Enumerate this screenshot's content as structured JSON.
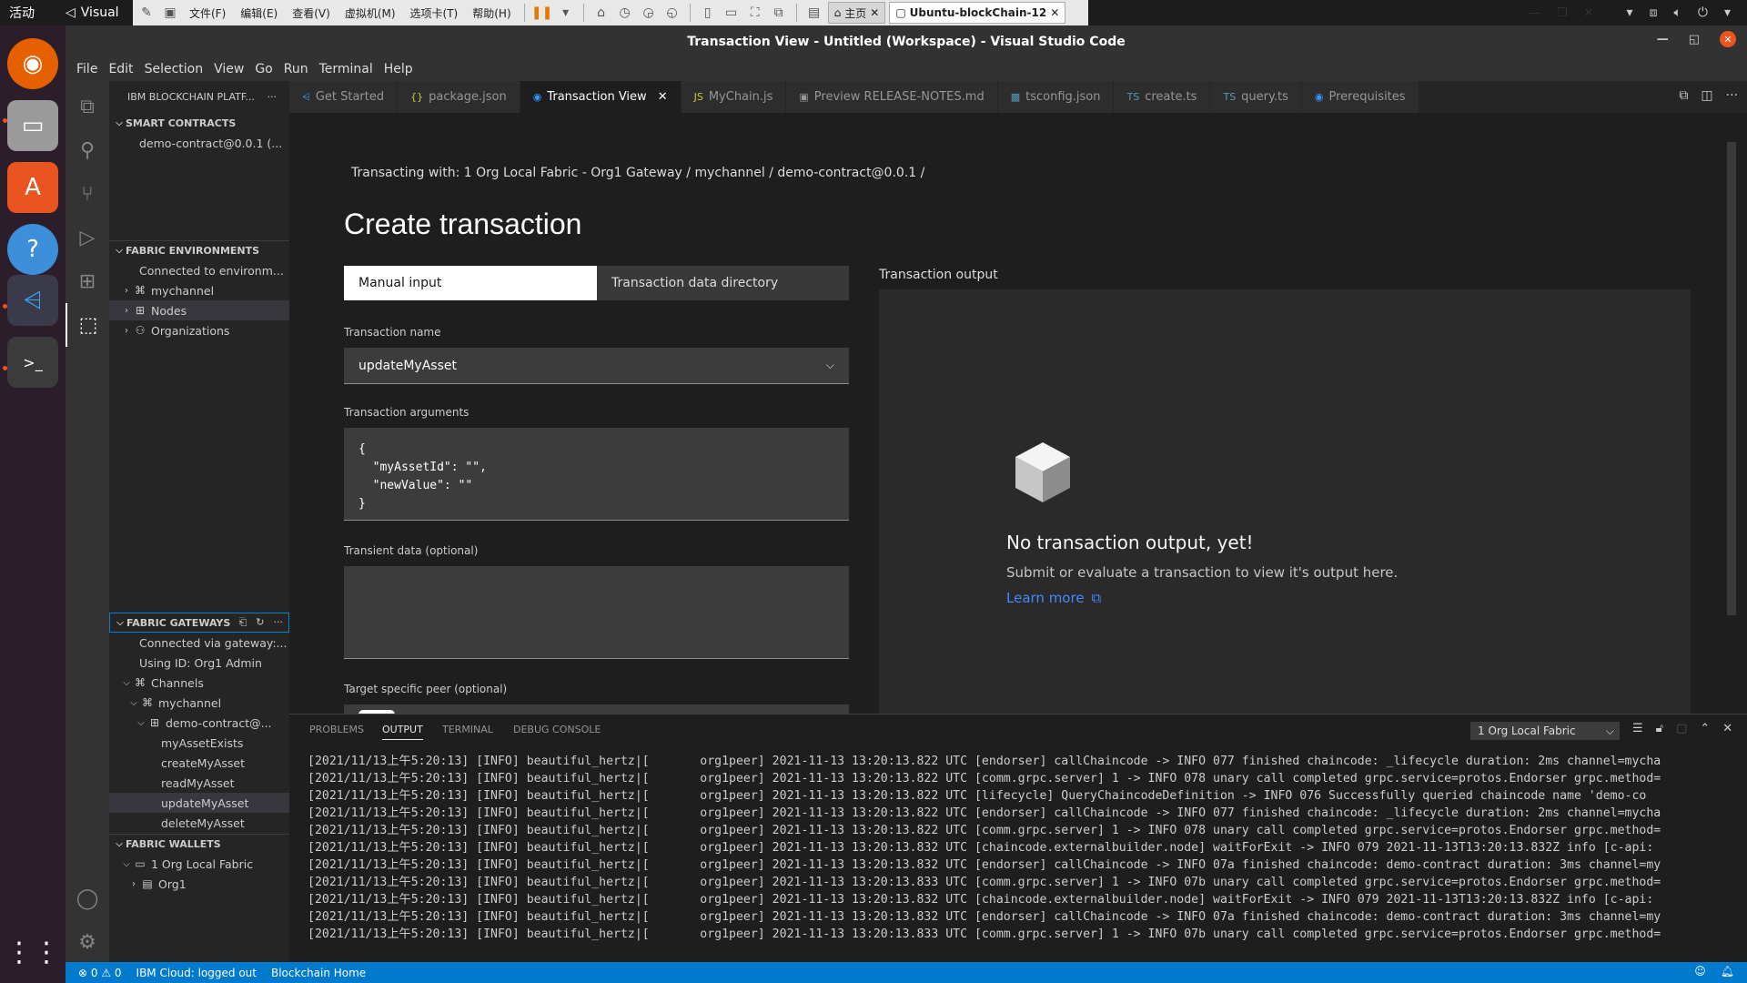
{
  "system": {
    "activities": "活动",
    "app_short": "Visual",
    "vm_menu": [
      "文件(F)",
      "编辑(E)",
      "查看(V)",
      "虚拟机(M)",
      "选项卡(T)",
      "帮助(H)"
    ],
    "vm_tabs": [
      {
        "label": "主页",
        "active": false
      },
      {
        "label": "Ubuntu-blockChain-12",
        "active": true
      }
    ]
  },
  "window": {
    "title": "Transaction View - Untitled (Workspace) - Visual Studio Code",
    "menu": [
      "File",
      "Edit",
      "Selection",
      "View",
      "Go",
      "Run",
      "Terminal",
      "Help"
    ]
  },
  "sidebar": {
    "title": "IBM BLOCKCHAIN PLATF...",
    "smart_contracts": {
      "header": "SMART CONTRACTS",
      "items": [
        "demo-contract@0.0.1 (..."
      ]
    },
    "fabric_environments": {
      "header": "FABRIC ENVIRONMENTS",
      "connected": "Connected to environm...",
      "items": [
        "mychannel",
        "Nodes",
        "Organizations"
      ]
    },
    "fabric_gateways": {
      "header": "FABRIC GATEWAYS",
      "connected": "Connected via gateway:...",
      "using_id": "Using ID: Org1 Admin",
      "channels": "Channels",
      "channel": "mychannel",
      "contract": "demo-contract@...",
      "transactions": [
        "myAssetExists",
        "createMyAsset",
        "readMyAsset",
        "updateMyAsset",
        "deleteMyAsset"
      ]
    },
    "fabric_wallets": {
      "header": "FABRIC WALLETS",
      "wallet": "1 Org Local Fabric",
      "org": "Org1"
    }
  },
  "tabs": [
    {
      "label": "Get Started",
      "icon": "vscode-icon",
      "active": false
    },
    {
      "label": "package.json",
      "icon": "json-icon",
      "active": false
    },
    {
      "label": "Transaction View",
      "icon": "blockchain-icon",
      "active": true
    },
    {
      "label": "MyChain.js",
      "icon": "js-icon",
      "active": false
    },
    {
      "label": "Preview RELEASE-NOTES.md",
      "icon": "preview-icon",
      "active": false
    },
    {
      "label": "tsconfig.json",
      "icon": "tsconfig-icon",
      "active": false
    },
    {
      "label": "create.ts",
      "icon": "ts-icon",
      "active": false
    },
    {
      "label": "query.ts",
      "icon": "ts-icon",
      "active": false
    },
    {
      "label": "Prerequisites",
      "icon": "blockchain-icon",
      "active": false
    }
  ],
  "editor": {
    "breadcrumb": "Transacting with: 1 Org Local Fabric - Org1 Gateway  /  mychannel  /  demo-contract@0.0.1  /",
    "heading": "Create transaction",
    "seg_manual": "Manual input",
    "seg_directory": "Transaction data directory",
    "tx_name_label": "Transaction name",
    "tx_name_value": "updateMyAsset",
    "tx_args_label": "Transaction arguments",
    "tx_args_value": "{\n  \"myAssetId\": \"\",\n  \"newValue\": \"\"\n}",
    "transient_label": "Transient data (optional)",
    "transient_value": "",
    "target_peer_label": "Target specific peer (optional)",
    "output_title": "Transaction output",
    "no_output_title": "No transaction output, yet!",
    "no_output_desc": "Submit or evaluate a transaction to view it's output here.",
    "learn_more": "Learn more"
  },
  "panel": {
    "tabs": [
      "PROBLEMS",
      "OUTPUT",
      "TERMINAL",
      "DEBUG CONSOLE"
    ],
    "active_tab": "OUTPUT",
    "channel_select": "1 Org Local Fabric",
    "log": [
      "[2021/11/13上午5:20:13] [INFO] beautiful_hertz|[       org1peer] 2021-11-13 13:20:13.822 UTC [endorser] callChaincode -> INFO 077 finished chaincode: _lifecycle duration: 2ms channel=mycha",
      "[2021/11/13上午5:20:13] [INFO] beautiful_hertz|[       org1peer] 2021-11-13 13:20:13.822 UTC [comm.grpc.server] 1 -> INFO 078 unary call completed grpc.service=protos.Endorser grpc.method=",
      "[2021/11/13上午5:20:13] [INFO] beautiful_hertz|[       org1peer] 2021-11-13 13:20:13.822 UTC [lifecycle] QueryChaincodeDefinition -> INFO 076 Successfully queried chaincode name 'demo-co",
      "[2021/11/13上午5:20:13] [INFO] beautiful_hertz|[       org1peer] 2021-11-13 13:20:13.822 UTC [endorser] callChaincode -> INFO 077 finished chaincode: _lifecycle duration: 2ms channel=mycha",
      "[2021/11/13上午5:20:13] [INFO] beautiful_hertz|[       org1peer] 2021-11-13 13:20:13.822 UTC [comm.grpc.server] 1 -> INFO 078 unary call completed grpc.service=protos.Endorser grpc.method=",
      "[2021/11/13上午5:20:13] [INFO] beautiful_hertz|[       org1peer] 2021-11-13 13:20:13.832 UTC [chaincode.externalbuilder.node] waitForExit -> INFO 079 2021-11-13T13:20:13.832Z info [c-api:",
      "[2021/11/13上午5:20:13] [INFO] beautiful_hertz|[       org1peer] 2021-11-13 13:20:13.832 UTC [endorser] callChaincode -> INFO 07a finished chaincode: demo-contract duration: 3ms channel=my",
      "[2021/11/13上午5:20:13] [INFO] beautiful_hertz|[       org1peer] 2021-11-13 13:20:13.833 UTC [comm.grpc.server] 1 -> INFO 07b unary call completed grpc.service=protos.Endorser grpc.method=",
      "[2021/11/13上午5:20:13] [INFO] beautiful_hertz|[       org1peer] 2021-11-13 13:20:13.832 UTC [chaincode.externalbuilder.node] waitForExit -> INFO 079 2021-11-13T13:20:13.832Z info [c-api:",
      "[2021/11/13上午5:20:13] [INFO] beautiful_hertz|[       org1peer] 2021-11-13 13:20:13.832 UTC [endorser] callChaincode -> INFO 07a finished chaincode: demo-contract duration: 3ms channel=my",
      "[2021/11/13上午5:20:13] [INFO] beautiful_hertz|[       org1peer] 2021-11-13 13:20:13.833 UTC [comm.grpc.server] 1 -> INFO 07b unary call completed grpc.service=protos.Endorser grpc.method="
    ]
  },
  "statusbar": {
    "problems": "⊗ 0 ⚠ 0",
    "ibm_cloud": "IBM Cloud: logged out",
    "blockchain_home": "Blockchain Home"
  }
}
